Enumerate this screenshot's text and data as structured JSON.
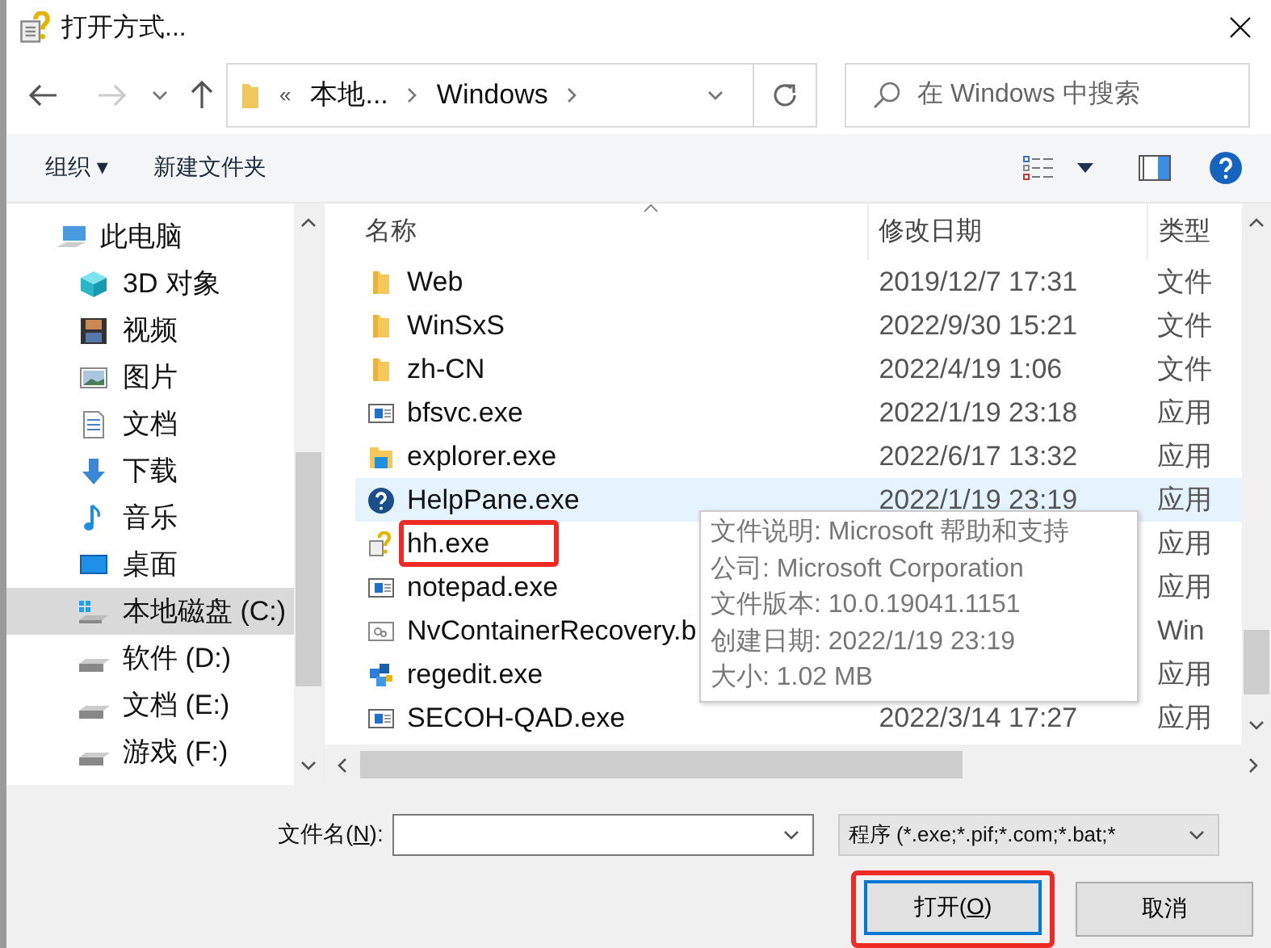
{
  "window": {
    "title": "打开方式..."
  },
  "nav": {
    "breadcrumb_overflow": "«",
    "path": [
      "本地...",
      "Windows"
    ],
    "search": {
      "placeholder": "在 Windows 中搜索"
    }
  },
  "toolbar": {
    "organize": "组织 ▾",
    "new_folder": "新建文件夹"
  },
  "sidebar": {
    "items": [
      {
        "label": "此电脑",
        "kind": "pc",
        "selected": false
      },
      {
        "label": "3D 对象",
        "kind": "cube",
        "selected": false
      },
      {
        "label": "视频",
        "kind": "video",
        "selected": false
      },
      {
        "label": "图片",
        "kind": "picture",
        "selected": false
      },
      {
        "label": "文档",
        "kind": "doc",
        "selected": false
      },
      {
        "label": "下载",
        "kind": "download",
        "selected": false
      },
      {
        "label": "音乐",
        "kind": "music",
        "selected": false
      },
      {
        "label": "桌面",
        "kind": "desktop",
        "selected": false
      },
      {
        "label": "本地磁盘 (C:)",
        "kind": "windrive",
        "selected": true
      },
      {
        "label": "软件 (D:)",
        "kind": "drive",
        "selected": false
      },
      {
        "label": "文档 (E:)",
        "kind": "drive",
        "selected": false
      },
      {
        "label": "游戏 (F:)",
        "kind": "drive",
        "selected": false
      }
    ]
  },
  "table": {
    "columns": [
      "名称",
      "修改日期",
      "类型"
    ],
    "rows": [
      {
        "name": "Web",
        "kind": "folder",
        "date": "2019/12/7 17:31",
        "type": "文件",
        "selected": false,
        "highlighted": false
      },
      {
        "name": "WinSxS",
        "kind": "folder",
        "date": "2022/9/30 15:21",
        "type": "文件",
        "selected": false,
        "highlighted": false
      },
      {
        "name": "zh-CN",
        "kind": "folder",
        "date": "2022/4/19 1:06",
        "type": "文件",
        "selected": false,
        "highlighted": false
      },
      {
        "name": "bfsvc.exe",
        "kind": "app",
        "date": "2022/1/19 23:18",
        "type": "应用",
        "selected": false,
        "highlighted": false
      },
      {
        "name": "explorer.exe",
        "kind": "explorer",
        "date": "2022/6/17 13:32",
        "type": "应用",
        "selected": false,
        "highlighted": false
      },
      {
        "name": "HelpPane.exe",
        "kind": "help",
        "date": "2022/1/19 23:19",
        "type": "应用",
        "selected": true,
        "highlighted": false
      },
      {
        "name": "hh.exe",
        "kind": "hh",
        "type": "应用",
        "selected": false,
        "highlighted": true
      },
      {
        "name": "notepad.exe",
        "kind": "app",
        "type": "应用",
        "selected": false,
        "highlighted": false
      },
      {
        "name": "NvContainerRecovery.b",
        "kind": "script",
        "type": "Win",
        "selected": false,
        "highlighted": false
      },
      {
        "name": "regedit.exe",
        "kind": "regedit",
        "type": "应用",
        "selected": false,
        "highlighted": false
      },
      {
        "name": "SECOH-QAD.exe",
        "kind": "app",
        "date": "2022/3/14 17:27",
        "type": "应用",
        "selected": false,
        "highlighted": false
      }
    ]
  },
  "tooltip": {
    "lines": [
      "文件说明: Microsoft 帮助和支持",
      "公司: Microsoft Corporation",
      "文件版本: 10.0.19041.1151",
      "创建日期: 2022/1/19 23:19",
      "大小: 1.02 MB"
    ]
  },
  "footer": {
    "filename_label": [
      "文件名(",
      "N",
      "):"
    ],
    "filetype": "程序 (*.exe;*.pif;*.com;*.bat;*",
    "buttons": [
      {
        "parts": [
          "打开(",
          "O",
          ")"
        ],
        "kind": "default",
        "highlighted": true
      },
      {
        "parts": [
          "取消"
        ],
        "kind": "normal",
        "highlighted": false
      }
    ]
  }
}
